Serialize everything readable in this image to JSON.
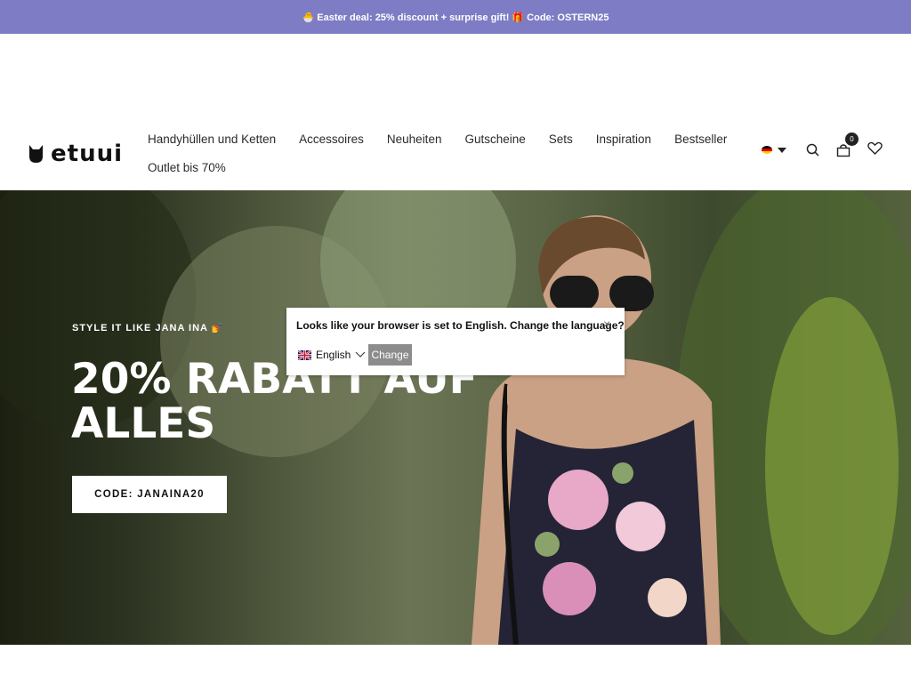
{
  "announcement": {
    "text": "🐣 Easter deal: 25% discount + surprise gift! 🎁 Code: OSTERN25"
  },
  "brand": {
    "name": "etuui"
  },
  "nav": {
    "row1": [
      "Handyhüllen und Ketten",
      "Accessoires",
      "Neuheiten",
      "Gutscheine",
      "Sets",
      "Inspiration",
      "Bestseller"
    ],
    "row2": [
      "Outlet bis 70%"
    ]
  },
  "header_tools": {
    "language_flag": "flag-de-icon",
    "cart_count": "0",
    "icons": [
      "search-icon",
      "cart-icon",
      "heart-icon"
    ]
  },
  "hero": {
    "kicker": "STYLE IT LIKE JANA INA 💅",
    "title": "20% RABATT AUF ALLES",
    "cta": "CODE: JANAINA20"
  },
  "language_popup": {
    "message": "Looks like your browser is set to English. Change the language?",
    "selected_language": "English",
    "change_button": "Change",
    "close_label": "×"
  },
  "colors": {
    "announcement_bg": "#7d7cc4",
    "popup_button_bg": "#8c8c8c"
  }
}
